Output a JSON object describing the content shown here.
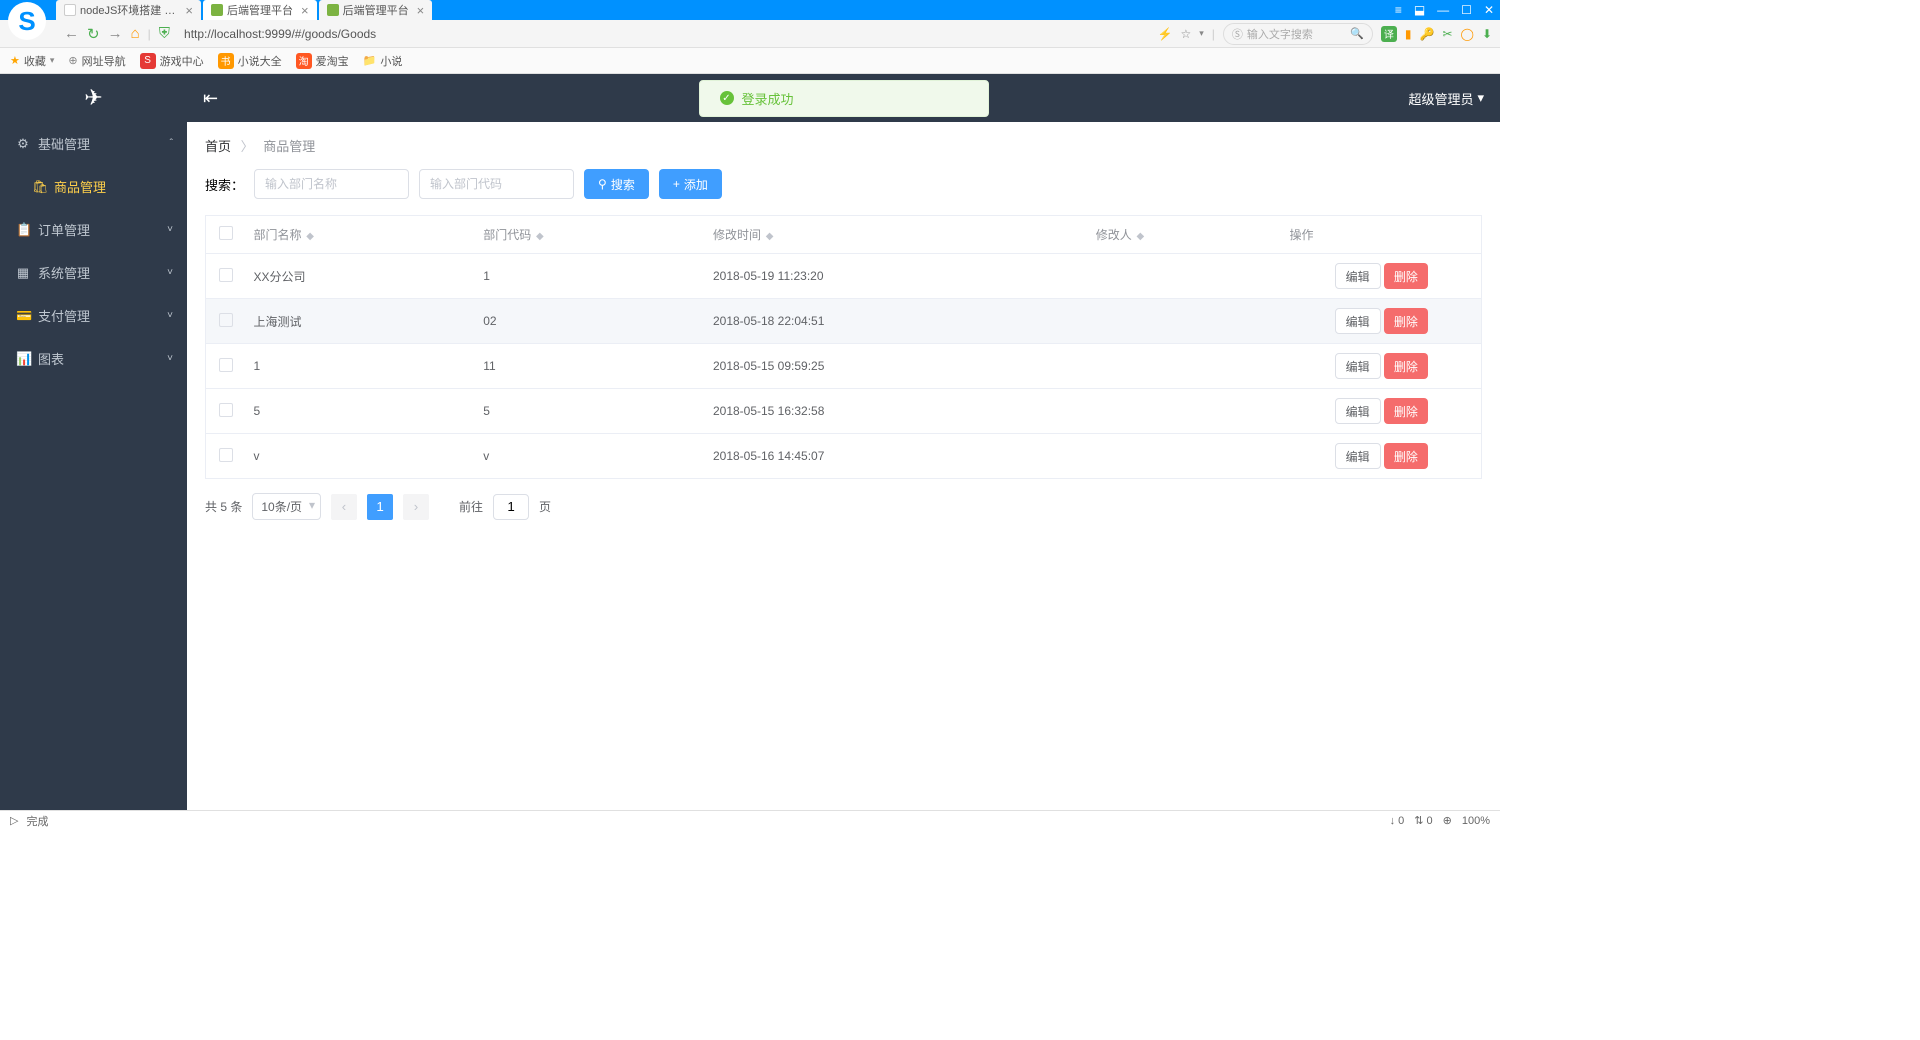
{
  "browser": {
    "tabs": [
      {
        "title": "nodeJS环境搭建 - javax",
        "active": false,
        "icon": "doc"
      },
      {
        "title": "后端管理平台",
        "active": true,
        "icon": "leaf"
      },
      {
        "title": "后端管理平台",
        "active": false,
        "icon": "leaf"
      }
    ],
    "url": "http://localhost:9999/#/goods/Goods",
    "search_placeholder": "输入文字搜索",
    "bookmarks": [
      {
        "icon": "★",
        "label": "收藏",
        "color": "#ffa500"
      },
      {
        "icon": "⊕",
        "label": "网址导航",
        "color": "#888"
      },
      {
        "icon": "S",
        "label": "游戏中心",
        "color": "#e53935",
        "bg": true
      },
      {
        "icon": "书",
        "label": "小说大全",
        "color": "#ff9800",
        "bg": true
      },
      {
        "icon": "淘",
        "label": "爱淘宝",
        "color": "#ff5722",
        "bg": true
      },
      {
        "icon": "📁",
        "label": "小说",
        "color": "#ffb300"
      }
    ]
  },
  "sidebar": {
    "items": [
      {
        "icon": "⚙",
        "label": "基础管理",
        "expanded": true,
        "chev": "ˆ"
      },
      {
        "icon": "🛍",
        "label": "商品管理",
        "sub": true,
        "active": true
      },
      {
        "icon": "📋",
        "label": "订单管理",
        "chev": "˅"
      },
      {
        "icon": "▦",
        "label": "系统管理",
        "chev": "˅"
      },
      {
        "icon": "💳",
        "label": "支付管理",
        "chev": "˅"
      },
      {
        "icon": "📊",
        "label": "图表",
        "chev": "˅"
      }
    ]
  },
  "topbar": {
    "toast": "登录成功",
    "user": "超级管理员"
  },
  "breadcrumb": {
    "home": "首页",
    "current": "商品管理"
  },
  "search": {
    "label": "搜索：",
    "name_placeholder": "输入部门名称",
    "code_placeholder": "输入部门代码",
    "search_btn": "搜索",
    "add_btn": "添加"
  },
  "table": {
    "headers": [
      "部门名称",
      "部门代码",
      "修改时间",
      "修改人",
      "操作"
    ],
    "rows": [
      {
        "name": "XX分公司",
        "code": "1",
        "time": "2018-05-19 11:23:20",
        "by": ""
      },
      {
        "name": "上海测试",
        "code": "02",
        "time": "2018-05-18 22:04:51",
        "by": "",
        "hover": true
      },
      {
        "name": "1",
        "code": "11",
        "time": "2018-05-15 09:59:25",
        "by": "",
        "link": true
      },
      {
        "name": "5",
        "code": "5",
        "time": "2018-05-15 16:32:58",
        "by": ""
      },
      {
        "name": "v",
        "code": "v",
        "time": "2018-05-16 14:45:07",
        "by": ""
      }
    ],
    "edit_btn": "编辑",
    "delete_btn": "删除"
  },
  "pagination": {
    "total": "共 5 条",
    "per_page": "10条/页",
    "current": "1",
    "goto_label": "前往",
    "goto_value": "1",
    "page_suffix": "页"
  },
  "statusbar": {
    "status": "完成",
    "download": "↓ 0",
    "speed": "⇅ 0",
    "zoom": "100%"
  }
}
